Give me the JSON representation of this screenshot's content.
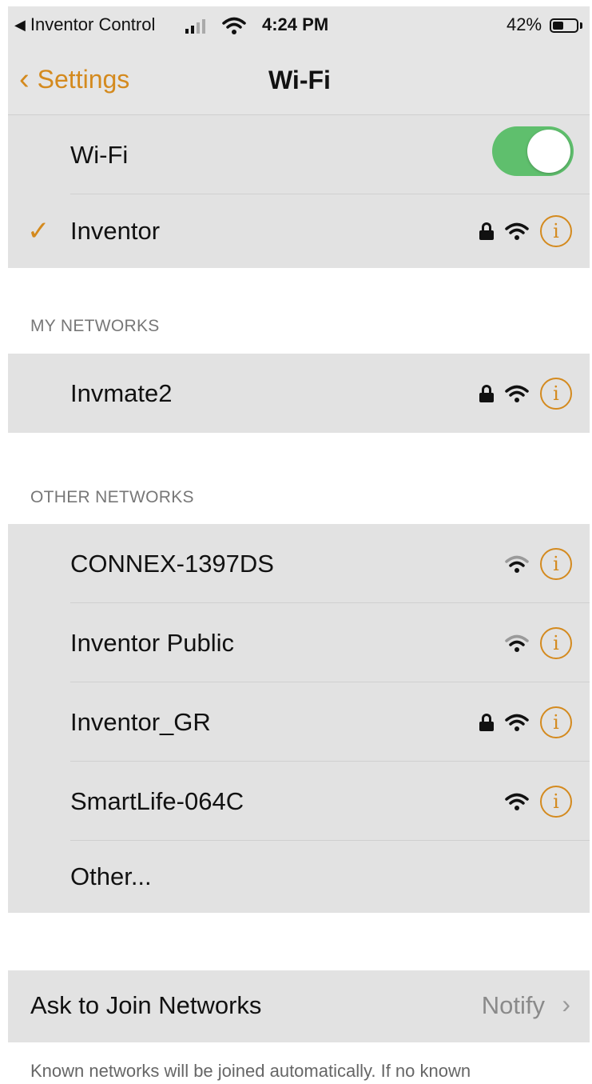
{
  "status_bar": {
    "back_app": "Inventor Control",
    "time": "4:24 PM",
    "battery": "42%",
    "battery_level": 0.42
  },
  "nav": {
    "back_label": "Settings",
    "title": "Wi-Fi"
  },
  "wifi": {
    "label": "Wi-Fi",
    "enabled": true,
    "connected_network": "Inventor"
  },
  "my_networks": {
    "header": "MY NETWORKS",
    "items": [
      {
        "name": "Invmate2",
        "locked": true
      }
    ]
  },
  "other_networks": {
    "header": "OTHER NETWORKS",
    "items": [
      {
        "name": "CONNEX-1397DS",
        "locked": false
      },
      {
        "name": "Inventor Public",
        "locked": false
      },
      {
        "name": "Inventor_GR",
        "locked": true
      },
      {
        "name": "SmartLife-064C",
        "locked": false
      }
    ],
    "other_label": "Other..."
  },
  "ask_to_join": {
    "label": "Ask to Join Networks",
    "value": "Notify"
  },
  "footer_text": "Known networks will be joined automatically. If no known",
  "colors": {
    "accent": "#d48a1e",
    "toggle_on": "#5fbf6d",
    "row_bg": "#e2e2e2"
  }
}
